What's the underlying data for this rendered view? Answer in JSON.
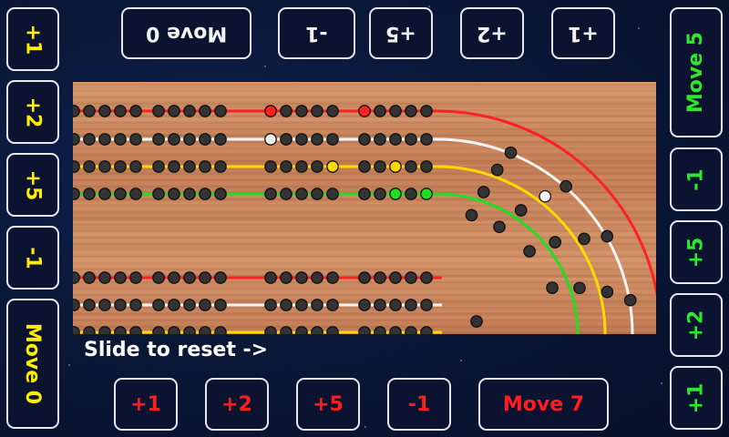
{
  "top_bar": {
    "move_label": "Move 0",
    "buttons": [
      "-1",
      "+5",
      "+2",
      "+1"
    ]
  },
  "left_bar": {
    "buttons": [
      "+1",
      "+2",
      "+5",
      "-1"
    ],
    "move_label": "Move 0"
  },
  "right_bar": {
    "move_label": "Move 5",
    "buttons": [
      "-1",
      "+5",
      "+2",
      "+1"
    ]
  },
  "bottom_bar": {
    "buttons": [
      "+1",
      "+2",
      "+5",
      "-1"
    ],
    "move_label": "Move 7"
  },
  "board": {
    "reset_hint": "Slide to reset ->",
    "tracks": [
      {
        "color": "red",
        "hex": "#ff2020"
      },
      {
        "color": "white",
        "hex": "#f4f4f4"
      },
      {
        "color": "yellow",
        "hex": "#ffd800"
      },
      {
        "color": "green",
        "hex": "#22dd22"
      }
    ],
    "hole_color": "#333333"
  }
}
